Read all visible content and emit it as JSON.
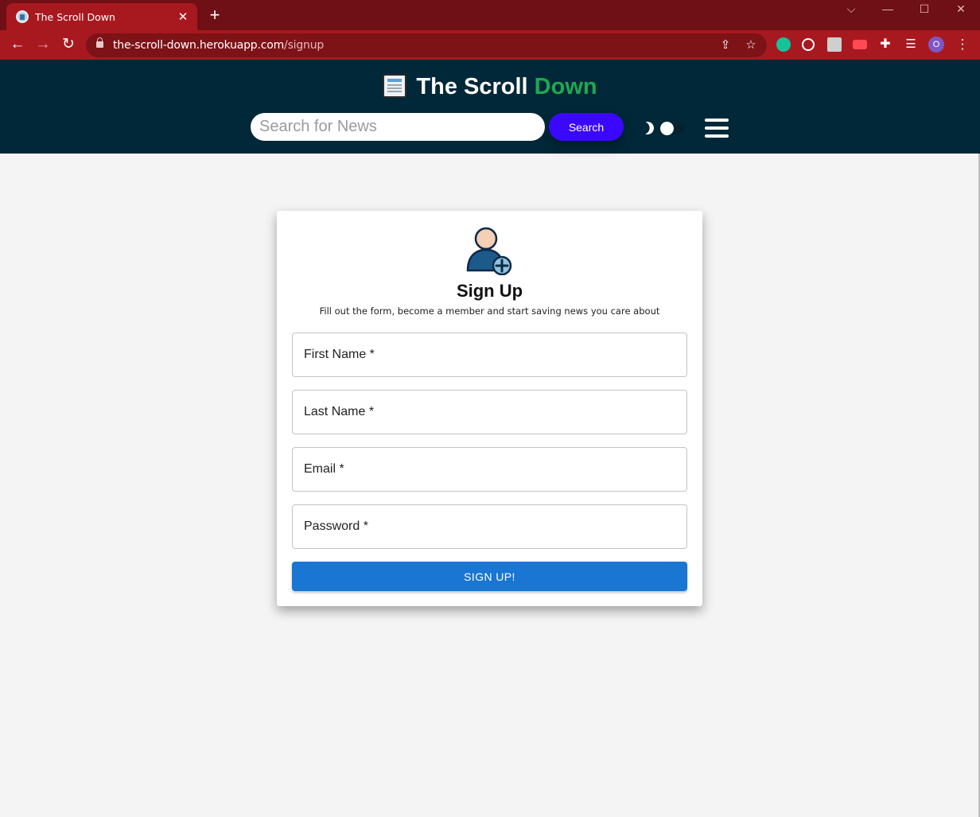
{
  "browser": {
    "tab_title": "The Scroll Down",
    "tab_close": "✕",
    "new_tab": "+",
    "url_domain": "the-scroll-down.herokuapp.com",
    "url_path": "/signup",
    "profile_initial": "O",
    "window_controls": {
      "dropdown": "⌵",
      "minimize": "—",
      "maximize": "☐",
      "close": "✕"
    },
    "nav": {
      "back": "←",
      "forward": "→",
      "reload": "↻"
    }
  },
  "header": {
    "brand_first": "The Scroll",
    "brand_second": "Down",
    "search_placeholder": "Search for News",
    "search_button": "Search"
  },
  "signup": {
    "title": "Sign Up",
    "subtitle": "Fill out the form, become a member and start saving news you care about",
    "fields": [
      {
        "label": "First Name *"
      },
      {
        "label": "Last Name *"
      },
      {
        "label": "Email *"
      },
      {
        "label": "Password *"
      }
    ],
    "submit_label": "SIGN UP!"
  },
  "colors": {
    "brand_accent": "#1fa851",
    "header_bg": "#012838",
    "search_button": "#3b08ff",
    "submit_button": "#1976d2",
    "browser_frame": "#a8191f"
  }
}
